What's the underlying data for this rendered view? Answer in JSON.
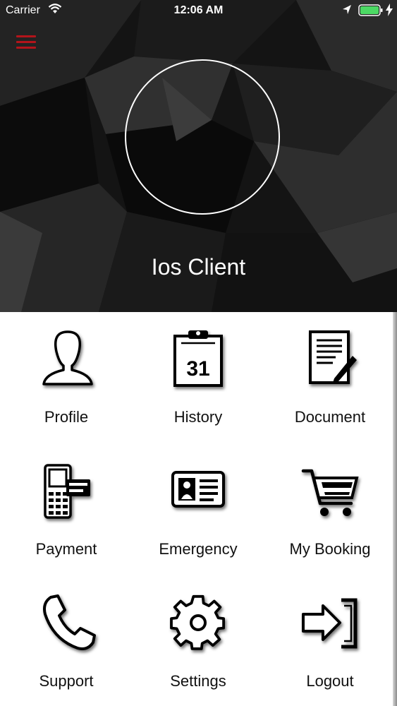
{
  "status_bar": {
    "carrier": "Carrier",
    "time": "12:06 AM",
    "wifi_icon": "wifi-icon",
    "location_icon": "location-arrow-icon",
    "battery_icon": "battery-full-icon",
    "charging_icon": "charging-bolt-icon"
  },
  "header": {
    "menu_icon": "hamburger-menu-icon",
    "menu_color": "#b3141b",
    "user_name": "Ios Client"
  },
  "menu": {
    "items": [
      {
        "label": "Profile",
        "icon": "person-icon"
      },
      {
        "label": "History",
        "icon": "calendar-icon"
      },
      {
        "label": "Document",
        "icon": "document-icon"
      },
      {
        "label": "Payment",
        "icon": "payment-terminal-icon"
      },
      {
        "label": "Emergency",
        "icon": "id-card-icon"
      },
      {
        "label": "My Booking",
        "icon": "shopping-cart-icon"
      },
      {
        "label": "Support",
        "icon": "phone-icon"
      },
      {
        "label": "Settings",
        "icon": "gear-icon"
      },
      {
        "label": "Logout",
        "icon": "logout-icon"
      }
    ],
    "calendar_day": "31"
  }
}
